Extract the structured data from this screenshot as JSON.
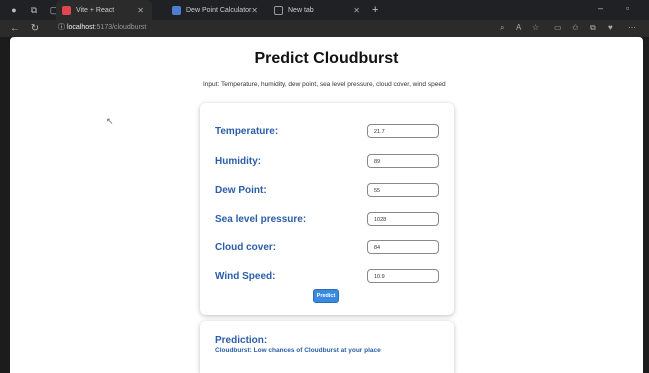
{
  "browser": {
    "tabs": [
      {
        "title": "Vite + React",
        "color": "#e0464f"
      },
      {
        "title": "Dew Point Calculator",
        "color": "#4d7fd1"
      },
      {
        "title": "New tab",
        "color": "#999999"
      }
    ],
    "url_host": "localhost",
    "url_rest": ":5173/cloudburst"
  },
  "page": {
    "title": "Predict Cloudburst",
    "subtitle": "Input: Temperature, humidity, dew point, sea level pressure, cloud cover, wind speed"
  },
  "form": {
    "fields": [
      {
        "label": "Temperature:",
        "value": "21.7"
      },
      {
        "label": "Humidity:",
        "value": "89"
      },
      {
        "label": "Dew Point:",
        "value": "55"
      },
      {
        "label": "Sea level pressure:",
        "value": "1028"
      },
      {
        "label": "Cloud cover:",
        "value": "84"
      },
      {
        "label": "Wind Speed:",
        "value": "10.9"
      }
    ],
    "submit_label": "Predict"
  },
  "prediction": {
    "heading": "Prediction:",
    "text": "Cloudburst: Low chances of Cloudburst at your place"
  },
  "colors": {
    "accent": "#2a5ea8",
    "button": "#3a8be0"
  }
}
